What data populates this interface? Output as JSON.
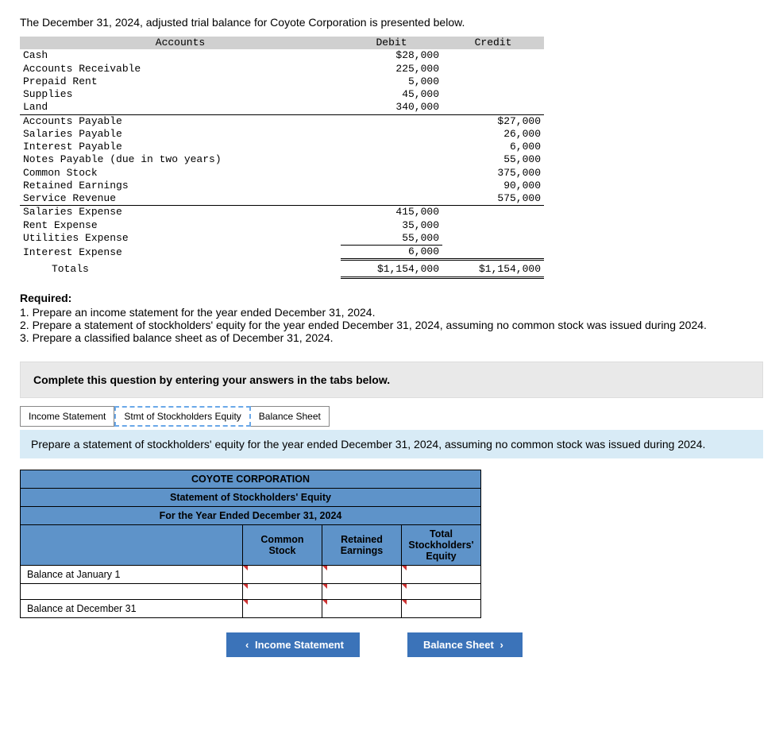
{
  "intro": "The December 31, 2024, adjusted trial balance for Coyote Corporation is presented below.",
  "tb": {
    "head": {
      "accounts": "Accounts",
      "debit": "Debit",
      "credit": "Credit"
    },
    "rows": [
      {
        "acc": "Cash",
        "debit": "$28,000",
        "credit": ""
      },
      {
        "acc": "Accounts Receivable",
        "debit": "225,000",
        "credit": ""
      },
      {
        "acc": "Prepaid Rent",
        "debit": "5,000",
        "credit": ""
      },
      {
        "acc": "Supplies",
        "debit": "45,000",
        "credit": ""
      },
      {
        "acc": "Land",
        "debit": "340,000",
        "credit": ""
      },
      {
        "acc": "Accounts Payable",
        "debit": "",
        "credit": "$27,000"
      },
      {
        "acc": "Salaries Payable",
        "debit": "",
        "credit": "26,000"
      },
      {
        "acc": "Interest Payable",
        "debit": "",
        "credit": "6,000"
      },
      {
        "acc": "Notes Payable (due in two years)",
        "debit": "",
        "credit": "55,000"
      },
      {
        "acc": "Common Stock",
        "debit": "",
        "credit": "375,000"
      },
      {
        "acc": "Retained Earnings",
        "debit": "",
        "credit": "90,000"
      },
      {
        "acc": "Service Revenue",
        "debit": "",
        "credit": "575,000"
      },
      {
        "acc": "Salaries Expense",
        "debit": "415,000",
        "credit": ""
      },
      {
        "acc": "Rent Expense",
        "debit": "35,000",
        "credit": ""
      },
      {
        "acc": "Utilities Expense",
        "debit": "55,000",
        "credit": ""
      },
      {
        "acc": "Interest Expense",
        "debit": "6,000",
        "credit": ""
      }
    ],
    "totals": {
      "label": "Totals",
      "debit": "$1,154,000",
      "credit": "$1,154,000"
    }
  },
  "required": {
    "head": "Required:",
    "items": [
      "1. Prepare an income statement for the year ended December 31, 2024.",
      "2. Prepare a statement of stockholders' equity for the year ended December 31, 2024, assuming no common stock was issued during 2024.",
      "3. Prepare a classified balance sheet as of December 31, 2024."
    ]
  },
  "grey_instruction": "Complete this question by entering your answers in the tabs below.",
  "tabs": {
    "income": "Income Statement",
    "equity": "Stmt of Stockholders Equity",
    "balance": "Balance Sheet"
  },
  "blue_instruction": "Prepare a statement of stockholders' equity for the year ended December 31, 2024, assuming no common stock was issued during 2024.",
  "stmt": {
    "title1": "COYOTE CORPORATION",
    "title2": "Statement of Stockholders' Equity",
    "title3": "For the Year Ended December 31, 2024",
    "cols": {
      "c1": "Common Stock",
      "c2": "Retained Earnings",
      "c3": "Total Stockholders' Equity"
    },
    "rows": {
      "r1": "Balance at January 1",
      "r2": "",
      "r3": "Balance at December 31"
    }
  },
  "nav": {
    "prev": "Income Statement",
    "next": "Balance Sheet"
  }
}
